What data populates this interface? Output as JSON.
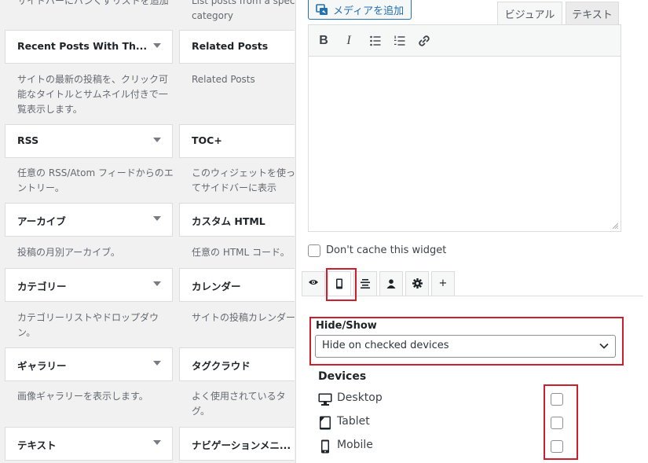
{
  "left": {
    "top_desc_a": "サイドバーにバンくずリストを追加",
    "top_desc_b1": "List posts from a specified",
    "top_desc_b2": "category",
    "col_a": [
      {
        "title": "Recent Posts With Th...",
        "desc": "サイトの最新の投稿を、クリック可能なタイトルとサムネイル付きで一覧表示します。"
      },
      {
        "title": "RSS",
        "desc": "任意の RSS/Atom フィードからのエントリー。"
      },
      {
        "title": "アーカイブ",
        "desc": "投稿の月別アーカイブ。"
      },
      {
        "title": "カテゴリー",
        "desc": "カテゴリーリストやドロップダウン。"
      },
      {
        "title": "ギャラリー",
        "desc": "画像ギャラリーを表示します。"
      },
      {
        "title": "テキスト",
        "desc": ""
      }
    ],
    "col_b": [
      {
        "title": "Related Posts",
        "desc": "Related Posts"
      },
      {
        "title": "TOC+",
        "desc": "このウィジェットを使ってサイドバーに表示"
      },
      {
        "title": "カスタム HTML",
        "desc": "任意の HTML コード。"
      },
      {
        "title": "カレンダー",
        "desc": "サイトの投稿カレンダー"
      },
      {
        "title": "タグクラウド",
        "desc": "よく使用されているタグ。"
      },
      {
        "title": "ナビゲーションメニ...",
        "desc": ""
      }
    ]
  },
  "editor": {
    "add_media": "メディアを追加",
    "tab_visual": "ビジュアル",
    "tab_text": "テキスト",
    "toolbar": {
      "bold": "B",
      "italic": "I"
    }
  },
  "cache": {
    "label": "Don't cache this widget",
    "checked": false
  },
  "visibility_tabs": [
    {
      "icon": "eye-icon",
      "glyph": "👁"
    },
    {
      "icon": "mobile-icon",
      "glyph": ""
    },
    {
      "icon": "align-icon",
      "glyph": ""
    },
    {
      "icon": "user-icon",
      "glyph": ""
    },
    {
      "icon": "gear-icon",
      "glyph": "⚙"
    },
    {
      "icon": "plus-icon",
      "glyph": "+"
    }
  ],
  "hide_show": {
    "label": "Hide/Show",
    "selected": "Hide on checked devices"
  },
  "devices": {
    "label": "Devices",
    "items": [
      {
        "label": "Desktop",
        "icon": "desktop-icon",
        "checked": false
      },
      {
        "label": "Tablet",
        "icon": "tablet-icon",
        "checked": false
      },
      {
        "label": "Mobile",
        "icon": "mobile-icon",
        "checked": false
      }
    ]
  },
  "colors": {
    "highlight": "#cc1f2d",
    "link": "#2271b1"
  }
}
